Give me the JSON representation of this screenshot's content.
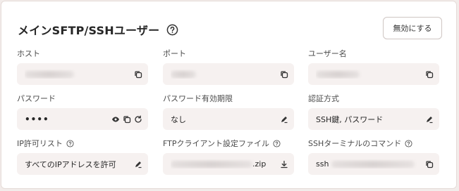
{
  "section": {
    "title": "メインSFTP/SSHユーザー",
    "disable_button": "無効にする"
  },
  "fields": {
    "host": {
      "label": "ホスト",
      "value": ""
    },
    "port": {
      "label": "ポート",
      "value": ""
    },
    "username": {
      "label": "ユーザー名",
      "value": ""
    },
    "password": {
      "label": "パスワード",
      "value": "••••"
    },
    "password_expiry": {
      "label": "パスワード有効期限",
      "value": "なし"
    },
    "auth_method": {
      "label": "認証方式",
      "value": "SSH鍵, パスワード"
    },
    "ip_allowlist": {
      "label": "IP許可リスト",
      "value": "すべてのIPアドレスを許可"
    },
    "ftp_config_file": {
      "label": "FTPクライアント設定ファイル",
      "value_suffix": ".zip"
    },
    "ssh_command": {
      "label": "SSHターミナルのコマンド",
      "value_prefix": "ssh"
    }
  },
  "icons": {
    "copy": "copy-icon",
    "eye": "eye-icon",
    "refresh": "refresh-icon",
    "edit": "pencil-icon",
    "download": "download-icon",
    "help": "question-circle-icon"
  }
}
